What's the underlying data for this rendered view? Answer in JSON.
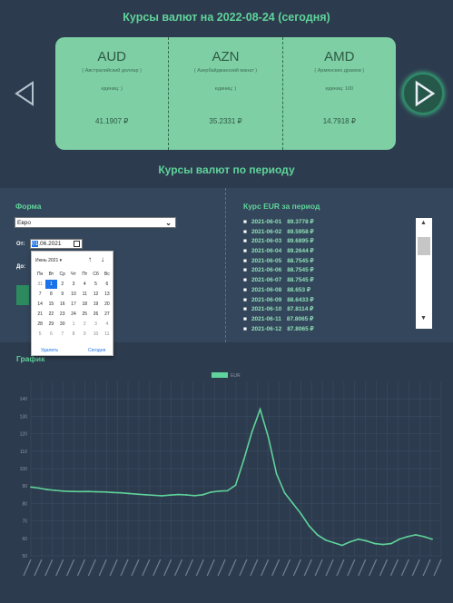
{
  "header": {
    "title": "Курсы валют на 2022-08-24 (сегодня)"
  },
  "cards": [
    {
      "code": "AUD",
      "name": "( Австралийский доллар )",
      "units": "единиц: )",
      "rate": "41.1907 ₽"
    },
    {
      "code": "AZN",
      "name": "( Азербайджанский манат )",
      "units": "единиц: )",
      "rate": "35.2331 ₽"
    },
    {
      "code": "AMD",
      "name": "( Армянских драмов )",
      "units": "единиц: 100",
      "rate": "14.7918 ₽"
    }
  ],
  "period": {
    "title": "Курсы валют по периоду"
  },
  "form": {
    "label": "Форма",
    "currency": "Евро",
    "from_label": "От:",
    "to_label": "До:",
    "from_day": "01",
    "from_rest": ".06.2021"
  },
  "datepicker": {
    "month": "Июнь 2021 ▾",
    "weekdays": [
      "Пн",
      "Вт",
      "Ср",
      "Чт",
      "Пт",
      "Сб",
      "Вс"
    ],
    "days": [
      "31",
      "1",
      "2",
      "3",
      "4",
      "5",
      "6",
      "7",
      "8",
      "9",
      "10",
      "11",
      "12",
      "13",
      "14",
      "15",
      "16",
      "17",
      "18",
      "19",
      "20",
      "21",
      "22",
      "23",
      "24",
      "25",
      "26",
      "27",
      "28",
      "29",
      "30",
      "1",
      "2",
      "3",
      "4",
      "5",
      "6",
      "7",
      "8",
      "9",
      "10",
      "11"
    ],
    "selected_day": "1",
    "clear": "Удалить",
    "today": "Сегодня"
  },
  "rates": {
    "label": "Курс EUR за период",
    "items": [
      {
        "date": "2021-06-01",
        "value": "89.3778 ₽"
      },
      {
        "date": "2021-06-02",
        "value": "89.5958 ₽"
      },
      {
        "date": "2021-06-03",
        "value": "89.6895 ₽"
      },
      {
        "date": "2021-06-04",
        "value": "89.2644 ₽"
      },
      {
        "date": "2021-06-05",
        "value": "88.7545 ₽"
      },
      {
        "date": "2021-06-06",
        "value": "88.7545 ₽"
      },
      {
        "date": "2021-06-07",
        "value": "88.7545 ₽"
      },
      {
        "date": "2021-06-08",
        "value": "88.653 ₽"
      },
      {
        "date": "2021-06-09",
        "value": "88.6433 ₽"
      },
      {
        "date": "2021-06-10",
        "value": "87.8114 ₽"
      },
      {
        "date": "2021-06-11",
        "value": "87.8065 ₽"
      },
      {
        "date": "2021-06-12",
        "value": "87.8065 ₽"
      }
    ]
  },
  "graph": {
    "label": "График"
  },
  "chart_data": {
    "type": "line",
    "legend": "EUR",
    "legend_position": "top-center",
    "color": "#5fd39a",
    "grid": true,
    "ylim": [
      50,
      150
    ],
    "yticks": [
      50,
      60,
      70,
      80,
      90,
      100,
      110,
      120,
      130,
      140
    ],
    "series": [
      {
        "name": "EUR",
        "values": [
          89.4,
          88.8,
          88.0,
          87.5,
          87.1,
          86.9,
          86.8,
          86.9,
          86.7,
          86.6,
          86.3,
          86.1,
          85.7,
          85.3,
          85.0,
          84.7,
          84.4,
          84.8,
          85.1,
          84.9,
          84.5,
          85.0,
          86.5,
          87.1,
          87.3,
          90.5,
          105.0,
          121.0,
          134.0,
          118.0,
          97.0,
          86.0,
          80.0,
          74.0,
          67.0,
          62.0,
          59.0,
          57.5,
          56.0,
          58.0,
          59.5,
          58.5,
          57.0,
          56.5,
          57.0,
          59.5,
          61.0,
          62.0,
          61.0,
          59.5
        ]
      }
    ]
  }
}
